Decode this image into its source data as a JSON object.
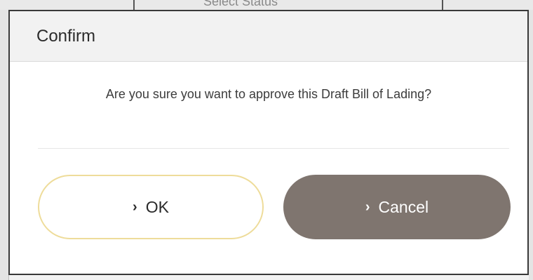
{
  "background": {
    "partial_text": "Select Status"
  },
  "dialog": {
    "title": "Confirm",
    "message": "Are you sure you want to approve this Draft Bill of Lading?",
    "ok_label": "OK",
    "cancel_label": "Cancel",
    "chevron_glyph": "›"
  },
  "colors": {
    "ok_border": "#eedc9a",
    "cancel_bg": "#7f756f"
  }
}
